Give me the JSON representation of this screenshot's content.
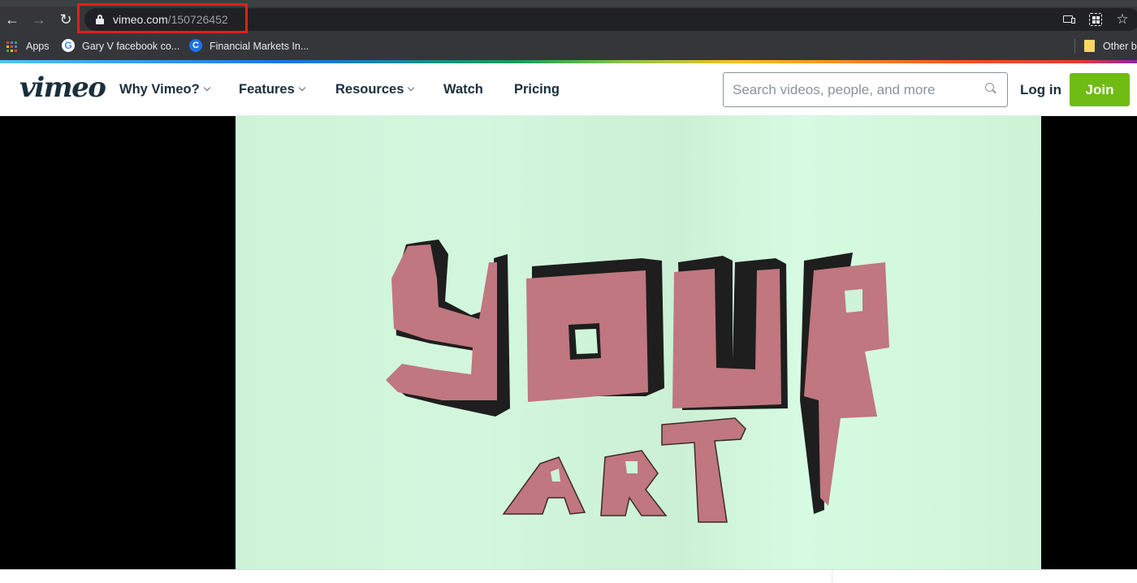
{
  "browser": {
    "url_domain": "vimeo.com",
    "url_path": "/150726452",
    "bookmarks": [
      {
        "label": "Apps",
        "icon": "apps-grid-icon"
      },
      {
        "label": "Gary V facebook co...",
        "icon": "google-icon"
      },
      {
        "label": "Financial Markets In...",
        "icon": "coursera-icon"
      }
    ],
    "other_bookmarks": "Other b",
    "toolbar_icons": [
      "cast-icon",
      "qr-code-icon",
      "bookmark-star-icon"
    ]
  },
  "header": {
    "logo": "vimeo",
    "nav": [
      {
        "label": "Why Vimeo?",
        "has_dropdown": true
      },
      {
        "label": "Features",
        "has_dropdown": true
      },
      {
        "label": "Resources",
        "has_dropdown": true
      },
      {
        "label": "Watch",
        "has_dropdown": false
      },
      {
        "label": "Pricing",
        "has_dropdown": false
      }
    ],
    "search_placeholder": "Search videos, people, and more",
    "search_value": "",
    "login_label": "Log in",
    "join_label": "Join",
    "join_color": "#6fbc15"
  },
  "video": {
    "frame_text_line1": "YOUR",
    "frame_text_line2": "ART",
    "letter_color": "#c0777f",
    "background_color": "#cdf3d8"
  }
}
